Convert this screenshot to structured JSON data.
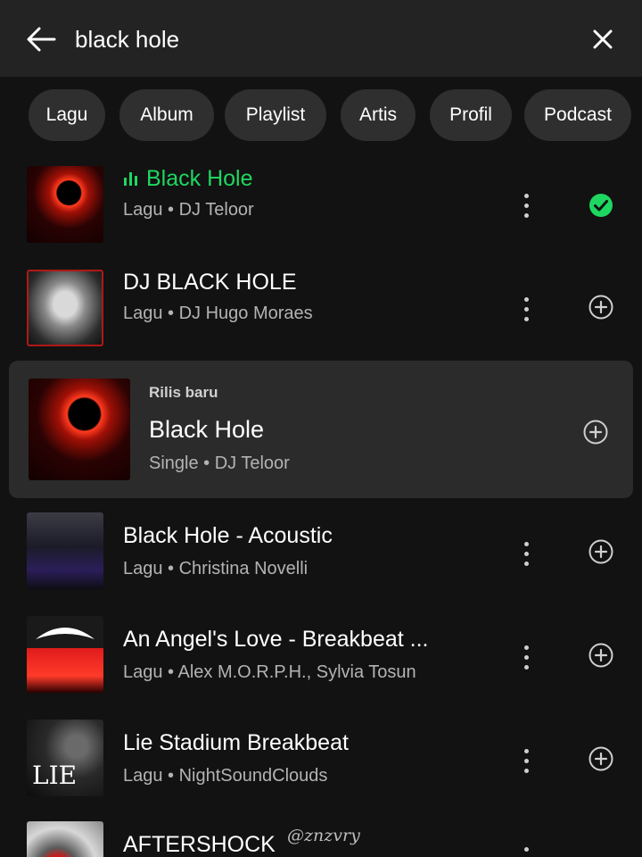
{
  "search": {
    "value": "black hole",
    "back_icon": "arrow-left-icon",
    "clear_icon": "close-icon"
  },
  "filters": [
    "Lagu",
    "Album",
    "Playlist",
    "Artis",
    "Profil",
    "Podcast"
  ],
  "results": [
    {
      "title": "Black Hole",
      "subtitle": "Lagu • DJ Teloor",
      "playing": true,
      "saved": true,
      "art": "black-hole-red-ring"
    },
    {
      "title": "DJ BLACK HOLE",
      "subtitle": "Lagu • DJ Hugo Moraes",
      "saved": false,
      "art": "dj-black-hole-photo"
    }
  ],
  "featured": {
    "label": "Rilis baru",
    "title": "Black Hole",
    "subtitle": "Single • DJ Teloor",
    "art": "black-hole-red-ring"
  },
  "results_more": [
    {
      "title": "Black Hole - Acoustic",
      "subtitle": "Lagu • Christina Novelli",
      "art": "acoustic-cover"
    },
    {
      "title": "An Angel's Love - Breakbeat ...",
      "subtitle": "Lagu • Alex M.O.R.P.H., Sylvia Tosun",
      "art": "armada-red-cover"
    },
    {
      "title": "Lie Stadium Breakbeat",
      "subtitle": "Lagu • NightSoundClouds",
      "art": "lie-cover"
    },
    {
      "title": "AFTERSHOCK",
      "subtitle": "",
      "art": "aftershock-cover"
    }
  ],
  "watermark": "@znzvry",
  "colors": {
    "accent": "#1ed760",
    "background": "#121212",
    "topbar": "#232323",
    "chip": "#2f2f2f",
    "featured_bg": "#2b2b2b"
  }
}
